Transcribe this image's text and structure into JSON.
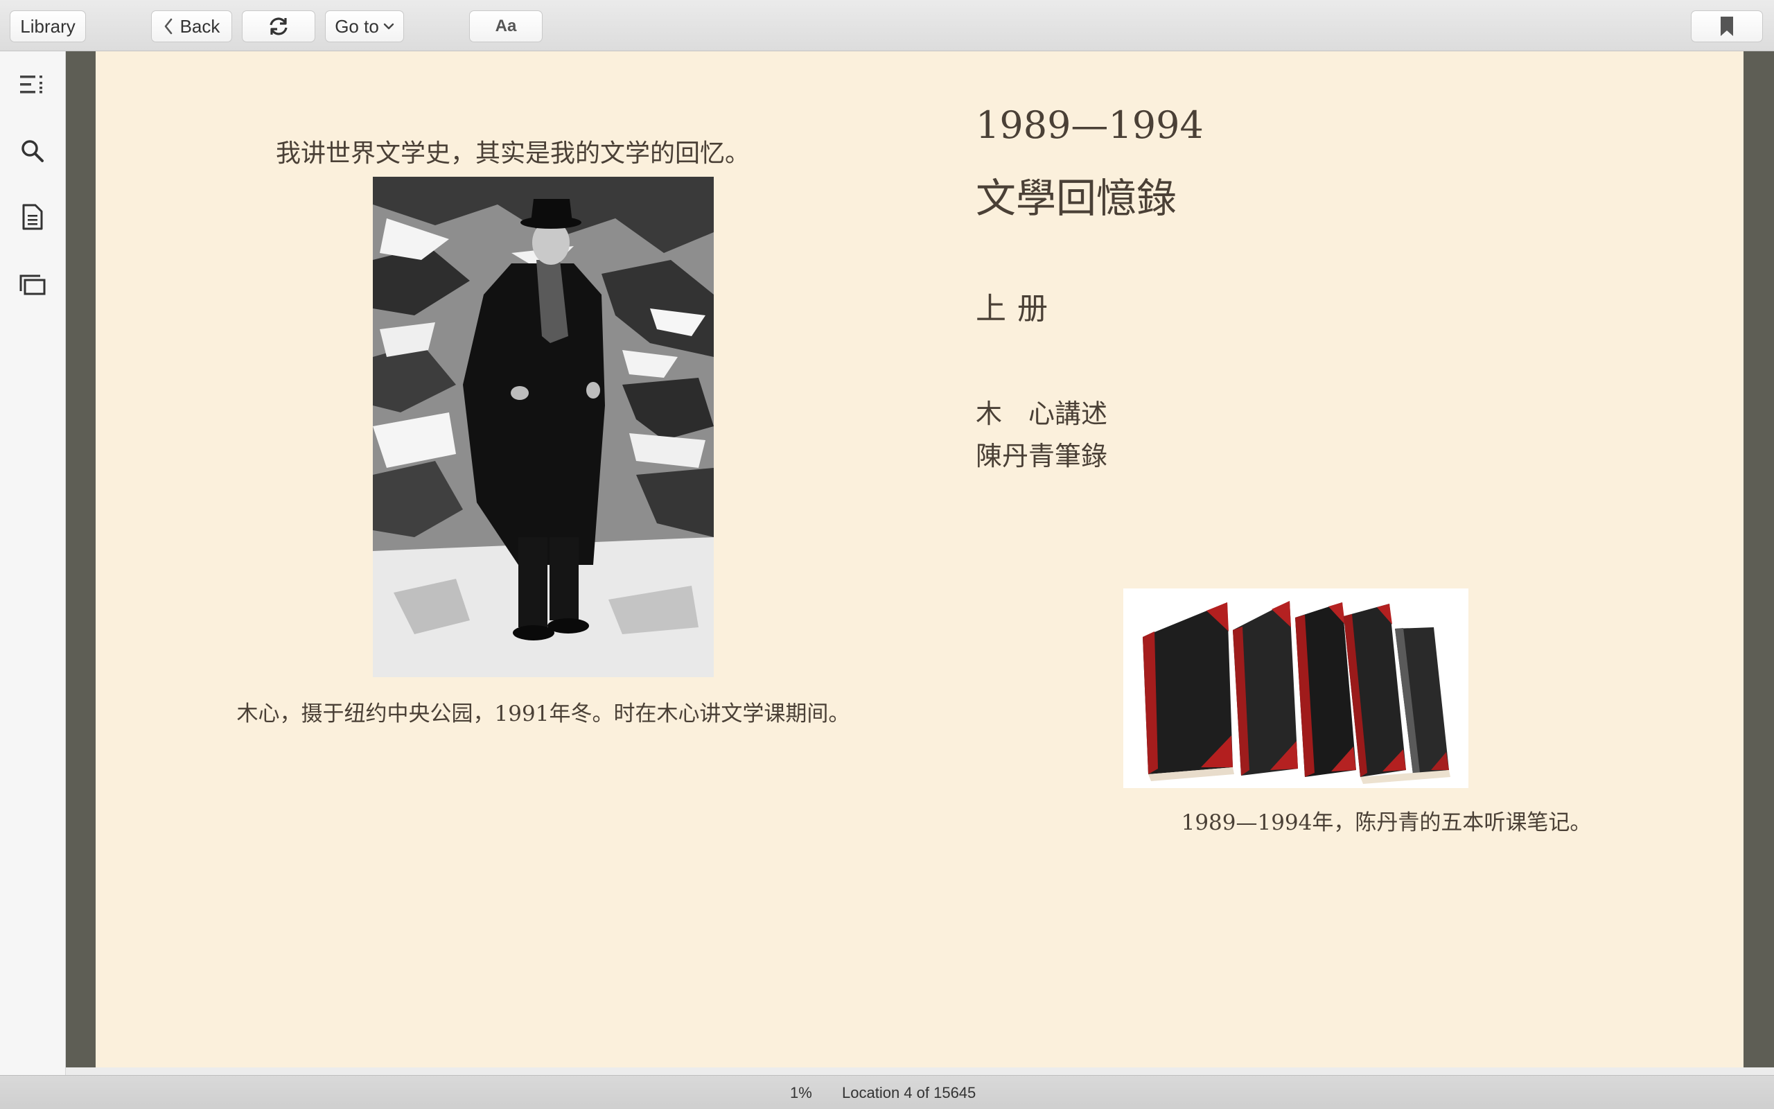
{
  "toolbar": {
    "library_label": "Library",
    "back_label": "Back",
    "goto_label": "Go to",
    "font_label": "Aa"
  },
  "sidebar": {
    "items": [
      {
        "icon": "table-of-contents-icon"
      },
      {
        "icon": "search-icon"
      },
      {
        "icon": "notes-icon"
      },
      {
        "icon": "flashcards-icon"
      }
    ]
  },
  "page": {
    "left": {
      "quote": "我讲世界文学史，其实是我的文学的回忆。",
      "photo_caption": "木心，摄于纽约中央公园，1991年冬。时在木心讲文学课期间。"
    },
    "right": {
      "years": "1989—1994",
      "title": "文學回憶錄",
      "volume": "上册",
      "author": "木　心講述",
      "recorder": "陳丹青筆錄",
      "books_caption": "1989—1994年，陈丹青的五本听课笔记。"
    }
  },
  "status": {
    "progress": "1%",
    "location": "Location 4 of 15645"
  },
  "colors": {
    "page_background": "#fbf0dc",
    "frame": "#5e5e55",
    "text": "#4a4036"
  }
}
